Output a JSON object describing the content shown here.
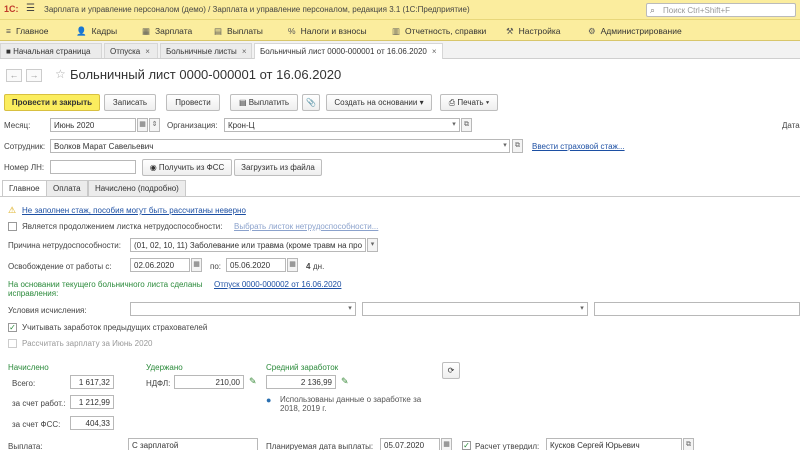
{
  "window": {
    "logo": "1С:",
    "menu_icon": "hamburger-icon",
    "title": "Зарплата и управление персоналом (демо) / Зарплата и управление персоналом, редакция 3.1 (1С:Предприятие)",
    "search_placeholder": "Поиск Ctrl+Shift+F"
  },
  "menu": [
    {
      "icon": "≡",
      "label": "Главное"
    },
    {
      "icon": "👤",
      "label": "Кадры"
    },
    {
      "icon": "▦",
      "label": "Зарплата"
    },
    {
      "icon": "▤",
      "label": "Выплаты"
    },
    {
      "icon": "%",
      "label": "Налоги и взносы"
    },
    {
      "icon": "▥",
      "label": "Отчетность, справки"
    },
    {
      "icon": "⚒",
      "label": "Настройка"
    },
    {
      "icon": "⚙",
      "label": "Администрирование"
    }
  ],
  "open_tabs": [
    {
      "label": "Начальная страница",
      "closable": false
    },
    {
      "label": "Отпуска",
      "closable": true
    },
    {
      "label": "Больничные листы",
      "closable": true
    },
    {
      "label": "Больничный лист 0000-000001 от 16.06.2020",
      "closable": true
    }
  ],
  "document": {
    "title": "Больничный лист 0000-000001 от 16.06.2020",
    "nav_back": "←",
    "nav_forward": "→"
  },
  "toolbar": {
    "post_close": "Провести и закрыть",
    "save": "Записать",
    "post": "Провести",
    "pay": "Выплатить",
    "attach_icon": "📎",
    "create_based": "Создать на основании",
    "print": "Печать"
  },
  "form": {
    "month_label": "Месяц:",
    "month_value": "Июнь 2020",
    "org_label": "Организация:",
    "org_value": "Крон-Ц",
    "date_label": "Дата",
    "employee_label": "Сотрудник:",
    "employee_value": "Волков Марат Савельевич",
    "enter_experience_link": "Ввести страховой стаж...",
    "ln_number_label": "Номер ЛН:",
    "ln_number_value": "",
    "get_from_fss": "Получить из ФСС",
    "load_from_file": "Загрузить из файла"
  },
  "inner_tabs": [
    "Главное",
    "Оплата",
    "Начислено (подробно)"
  ],
  "main_tab": {
    "warning_link": "Не заполнен стаж, пособия могут быть рассчитаны неверно",
    "continuation_label": "Является продолжением листка нетрудоспособности:",
    "choose_sick_leave_link": "Выбрать листок нетрудоспособности...",
    "reason_label": "Причина нетрудоспособности:",
    "reason_value": "(01, 02, 10, 11) Заболевание или травма (кроме травм на про",
    "release_label": "Освобождение от работы с:",
    "release_from": "02.06.2020",
    "release_to_label": "по:",
    "release_to": "05.06.2020",
    "days_count": "4",
    "days_unit": "дн.",
    "corrections_text_1": "На основании текущего больничного листа сделаны",
    "corrections_text_2": "исправления:",
    "corrections_link": "Отпуск 0000-000002 от 16.06.2020",
    "conditions_label": "Условия исчисления:",
    "consider_earnings_label": "Учитывать заработок предыдущих страхователей",
    "calc_salary_label": "Рассчитать зарплату за Июнь 2020",
    "accrued_header": "Начислено",
    "withheld_header": "Удержано",
    "avg_earnings_header": "Средний заработок",
    "total_label": "Всего:",
    "total_value": "1 617,32",
    "ndfl_label": "НДФЛ:",
    "ndfl_value": "210,00",
    "avg_value": "2 136,99",
    "employer_label": "за счет работ.:",
    "employer_value": "1 212,99",
    "fss_label": "за счет ФСС:",
    "fss_value": "404,33",
    "used_data_text_1": "Использованы данные о заработке за",
    "used_data_text_2": "2018, 2019 г.",
    "payout_label": "Выплата:",
    "payout_value": "С зарплатой",
    "planned_date_label": "Планируемая дата выплаты:",
    "planned_date_value": "05.07.2020",
    "calc_approved_label": "Расчет утвердил:",
    "calc_approved_value": "Кусков Сергей Юрьевич"
  }
}
